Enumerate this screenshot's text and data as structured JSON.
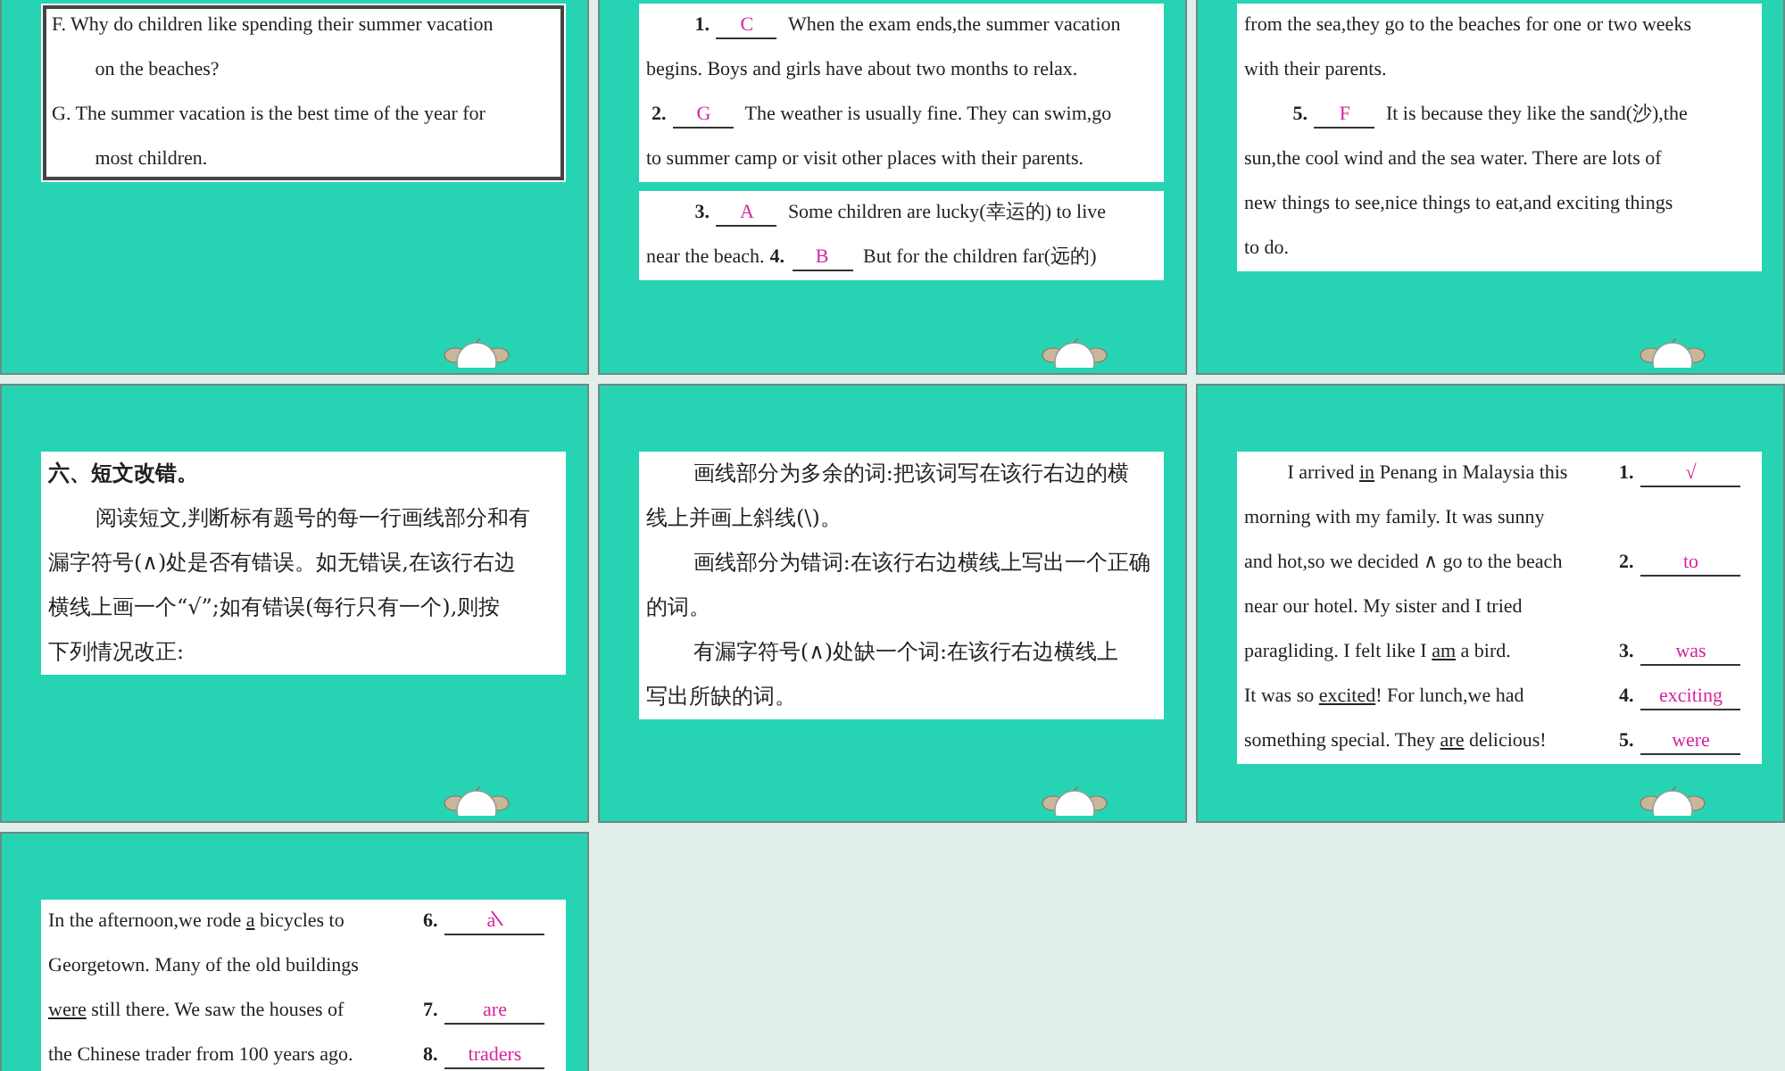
{
  "slides": [
    {
      "mascot": true,
      "boxes": [
        {
          "framed": true,
          "lines": [
            {
              "kind": "prose",
              "indent": false,
              "segments": [
                {
                  "kind": "text",
                  "text": "F. Why do children like spending their summer vacation"
                }
              ]
            },
            {
              "kind": "prose",
              "indent": true,
              "segments": [
                {
                  "kind": "text",
                  "text": "on the beaches?"
                }
              ]
            },
            {
              "kind": "prose",
              "indent": false,
              "segments": [
                {
                  "kind": "text",
                  "text": "G. The summer vacation is the best time of the year for"
                }
              ]
            },
            {
              "kind": "prose",
              "indent": true,
              "segments": [
                {
                  "kind": "text",
                  "text": "most children."
                }
              ]
            }
          ]
        }
      ]
    },
    {
      "mascot": true,
      "boxes": [
        {
          "framed": false,
          "lines": [
            {
              "kind": "prose",
              "indent": true,
              "segments": [
                {
                  "kind": "num",
                  "text": "1."
                },
                {
                  "kind": "answer",
                  "text": "C"
                },
                {
                  "kind": "text",
                  "text": "When the exam ends,the summer vacation"
                }
              ]
            },
            {
              "kind": "prose",
              "indent": false,
              "segments": [
                {
                  "kind": "text",
                  "text": "begins. Boys and girls have about two months to relax."
                }
              ]
            },
            {
              "kind": "prose",
              "indent": false,
              "segments": [
                {
                  "kind": "num",
                  "text": "2."
                },
                {
                  "kind": "answer",
                  "text": "G"
                },
                {
                  "kind": "text",
                  "text": "The weather is usually fine. They can swim,go"
                }
              ]
            },
            {
              "kind": "prose",
              "indent": false,
              "segments": [
                {
                  "kind": "text",
                  "text": "to summer camp or visit other places with their parents."
                }
              ]
            }
          ]
        },
        {
          "framed": false,
          "lines": [
            {
              "kind": "prose",
              "indent": true,
              "segments": [
                {
                  "kind": "num",
                  "text": "3."
                },
                {
                  "kind": "answer",
                  "text": "A"
                },
                {
                  "kind": "text",
                  "text": "Some children are lucky(幸运的) to live"
                }
              ]
            },
            {
              "kind": "prose",
              "indent": false,
              "segments": [
                {
                  "kind": "text",
                  "text": "near the beach."
                },
                {
                  "kind": "num",
                  "text": "4."
                },
                {
                  "kind": "answer",
                  "text": "B"
                },
                {
                  "kind": "text",
                  "text": "But for the children far(远的)"
                }
              ]
            }
          ]
        }
      ]
    },
    {
      "mascot": true,
      "boxes": [
        {
          "framed": false,
          "lines": [
            {
              "kind": "prose",
              "indent": false,
              "segments": [
                {
                  "kind": "text",
                  "text": "from the sea,they go to the beaches for one or two weeks"
                }
              ]
            },
            {
              "kind": "prose",
              "indent": false,
              "segments": [
                {
                  "kind": "text",
                  "text": "with their parents."
                }
              ]
            },
            {
              "kind": "prose",
              "indent": true,
              "segments": [
                {
                  "kind": "num",
                  "text": "5."
                },
                {
                  "kind": "answer",
                  "text": "F"
                },
                {
                  "kind": "text",
                  "text": "It is because they like the sand(沙),the"
                }
              ]
            },
            {
              "kind": "prose",
              "indent": false,
              "segments": [
                {
                  "kind": "text",
                  "text": "sun,the cool wind and the sea water. There are lots of"
                }
              ]
            },
            {
              "kind": "prose",
              "indent": false,
              "segments": [
                {
                  "kind": "text",
                  "text": "new things to see,nice things to eat,and exciting things"
                }
              ]
            },
            {
              "kind": "prose",
              "indent": false,
              "segments": [
                {
                  "kind": "text",
                  "text": "to do."
                }
              ]
            }
          ]
        }
      ]
    },
    {
      "mascot": true,
      "boxes": [
        {
          "framed": false,
          "lines": [
            {
              "kind": "heading",
              "indent": false,
              "segments": [
                {
                  "kind": "text",
                  "text": "六、短文改错。"
                }
              ]
            },
            {
              "kind": "chinese",
              "indent": true,
              "segments": [
                {
                  "kind": "text",
                  "text": "阅读短文,判断标有题号的每一行画线部分和有"
                }
              ]
            },
            {
              "kind": "chinese",
              "indent": false,
              "segments": [
                {
                  "kind": "text",
                  "text": "漏字符号(∧)处是否有错误。如无错误,在该行右边"
                }
              ]
            },
            {
              "kind": "chinese",
              "indent": false,
              "segments": [
                {
                  "kind": "text",
                  "text": "横线上画一个“√”;如有错误(每行只有一个),则按"
                }
              ]
            },
            {
              "kind": "chinese",
              "indent": false,
              "segments": [
                {
                  "kind": "text",
                  "text": "下列情况改正:"
                }
              ]
            }
          ]
        }
      ]
    },
    {
      "mascot": true,
      "boxes": [
        {
          "framed": false,
          "lines": [
            {
              "kind": "chinese",
              "indent": true,
              "segments": [
                {
                  "kind": "text",
                  "text": "画线部分为多余的词:把该词写在该行右边的横"
                }
              ]
            },
            {
              "kind": "chinese",
              "indent": false,
              "segments": [
                {
                  "kind": "text",
                  "text": "线上并画上斜线(\\)。"
                }
              ]
            },
            {
              "kind": "chinese",
              "indent": true,
              "segments": [
                {
                  "kind": "text",
                  "text": "画线部分为错词:在该行右边横线上写出一个正确"
                }
              ]
            },
            {
              "kind": "chinese",
              "indent": false,
              "segments": [
                {
                  "kind": "text",
                  "text": "的词。"
                }
              ]
            },
            {
              "kind": "chinese",
              "indent": true,
              "segments": [
                {
                  "kind": "text",
                  "text": "有漏字符号(∧)处缺一个词:在该行右边横线上"
                }
              ]
            },
            {
              "kind": "chinese",
              "indent": false,
              "segments": [
                {
                  "kind": "text",
                  "text": "写出所缺的词。"
                }
              ]
            }
          ]
        }
      ]
    },
    {
      "mascot": true,
      "boxes": [
        {
          "framed": false,
          "lines": [
            {
              "kind": "answer-row",
              "indent": true,
              "segments": [
                {
                  "kind": "text",
                  "text": "I arrived "
                },
                {
                  "kind": "underlined",
                  "text": "in"
                },
                {
                  "kind": "text",
                  "text": " Penang in Malaysia this"
                },
                {
                  "kind": "num",
                  "text": "1."
                },
                {
                  "kind": "answer",
                  "text": "√"
                }
              ]
            },
            {
              "kind": "answer-row",
              "indent": false,
              "segments": [
                {
                  "kind": "text",
                  "text": "morning with my family. It was sunny"
                }
              ]
            },
            {
              "kind": "answer-row",
              "indent": false,
              "segments": [
                {
                  "kind": "text",
                  "text": "and hot,so we decided ∧ go to the beach"
                },
                {
                  "kind": "num",
                  "text": "2."
                },
                {
                  "kind": "answer",
                  "text": "to"
                }
              ]
            },
            {
              "kind": "answer-row",
              "indent": false,
              "segments": [
                {
                  "kind": "text",
                  "text": "near our hotel. My sister and I tried"
                }
              ]
            },
            {
              "kind": "answer-row",
              "indent": false,
              "segments": [
                {
                  "kind": "text",
                  "text": "paragliding. I felt like I "
                },
                {
                  "kind": "underlined",
                  "text": "am"
                },
                {
                  "kind": "text",
                  "text": " a bird."
                },
                {
                  "kind": "num",
                  "text": "3."
                },
                {
                  "kind": "answer",
                  "text": "was"
                }
              ]
            },
            {
              "kind": "answer-row",
              "indent": false,
              "segments": [
                {
                  "kind": "text",
                  "text": "It was so "
                },
                {
                  "kind": "underlined",
                  "text": "excited"
                },
                {
                  "kind": "text",
                  "text": "! For lunch,we had"
                },
                {
                  "kind": "num",
                  "text": "4."
                },
                {
                  "kind": "answer",
                  "text": "exciting"
                }
              ]
            },
            {
              "kind": "answer-row",
              "indent": false,
              "segments": [
                {
                  "kind": "text",
                  "text": "something special. They "
                },
                {
                  "kind": "underlined",
                  "text": "are"
                },
                {
                  "kind": "text",
                  "text": " delicious!"
                },
                {
                  "kind": "num",
                  "text": "5."
                },
                {
                  "kind": "answer",
                  "text": "were"
                }
              ]
            }
          ]
        }
      ]
    },
    {
      "boxes": [
        {
          "framed": false,
          "lines": [
            {
              "kind": "answer-row",
              "indent": false,
              "segments": [
                {
                  "kind": "text",
                  "text": "In the afternoon,we rode "
                },
                {
                  "kind": "underlined",
                  "text": "a"
                },
                {
                  "kind": "text",
                  "text": " bicycles to"
                },
                {
                  "kind": "num",
                  "text": "6."
                },
                {
                  "kind": "answer-delete",
                  "text": "a"
                }
              ]
            },
            {
              "kind": "answer-row",
              "indent": false,
              "segments": [
                {
                  "kind": "text",
                  "text": "Georgetown. Many of the old buildings"
                }
              ]
            },
            {
              "kind": "answer-row",
              "indent": false,
              "segments": [
                {
                  "kind": "underlined",
                  "text": "were"
                },
                {
                  "kind": "text",
                  "text": " still there. We saw the houses of"
                },
                {
                  "kind": "num",
                  "text": "7."
                },
                {
                  "kind": "answer",
                  "text": "are"
                }
              ]
            },
            {
              "kind": "answer-row",
              "indent": false,
              "segments": [
                {
                  "kind": "text",
                  "text": "the Chinese trader from 100 years ago."
                },
                {
                  "kind": "num",
                  "text": "8."
                },
                {
                  "kind": "answer",
                  "text": "traders"
                }
              ]
            }
          ]
        }
      ]
    }
  ]
}
